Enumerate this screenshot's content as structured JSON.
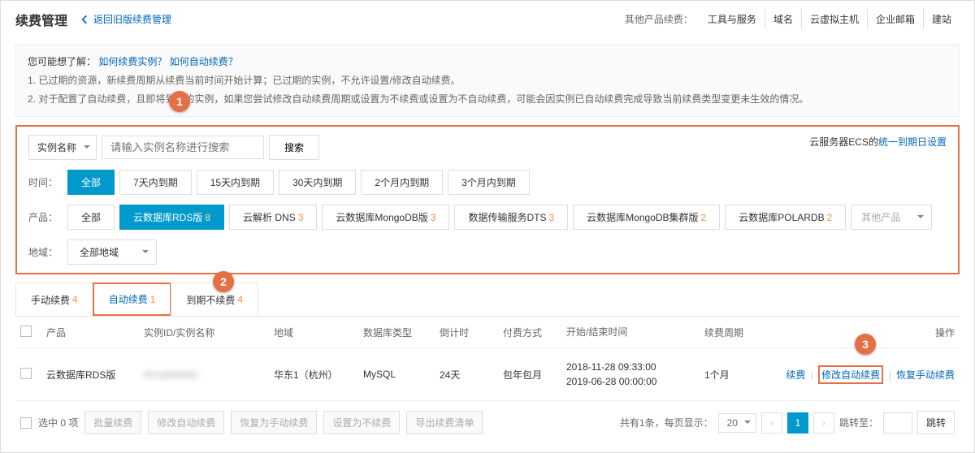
{
  "header": {
    "title": "续费管理",
    "back_link": "返回旧版续费管理",
    "other_label": "其他产品续费：",
    "top_links": [
      "工具与服务",
      "域名",
      "云虚拟主机",
      "企业邮箱",
      "建站"
    ]
  },
  "notice": {
    "you_may": "您可能想了解：",
    "link1": "如何续费实例？",
    "link2": "如何自动续费？",
    "line1": "1. 已过期的资源，新续费周期从续费当前时间开始计算；已过期的实例，不允许设置/修改自动续费。",
    "line2": "2. 对于配置了自动续费，且即将到期的实例，如果您尝试修改自动续费周期或设置为不续费或设置为不自动续费，可能会因实例已自动续费完成导致当前续费类型变更未生效的情况。"
  },
  "filter": {
    "search_type": "实例名称",
    "search_placeholder": "请输入实例名称进行搜索",
    "search_btn": "搜索",
    "ecs_prefix": "云服务器ECS的",
    "ecs_link": "统一到期日设置",
    "time_label": "时间：",
    "time_opts": [
      "全部",
      "7天内到期",
      "15天内到期",
      "30天内到期",
      "2个月内到期",
      "3个月内到期"
    ],
    "prod_label": "产品：",
    "prod_opts": [
      {
        "label": "全部",
        "count": ""
      },
      {
        "label": "云数据库RDS版",
        "count": "8"
      },
      {
        "label": "云解析 DNS",
        "count": "3"
      },
      {
        "label": "云数据库MongoDB版",
        "count": "3"
      },
      {
        "label": "数据传输服务DTS",
        "count": "3"
      },
      {
        "label": "云数据库MongoDB集群版",
        "count": "2"
      },
      {
        "label": "云数据库POLARDB",
        "count": "2"
      }
    ],
    "other_prod": "其他产品",
    "region_label": "地域：",
    "region_value": "全部地域"
  },
  "tabs": [
    {
      "label": "手动续费",
      "count": "4"
    },
    {
      "label": "自动续费",
      "count": "1"
    },
    {
      "label": "到期不续费",
      "count": "4"
    }
  ],
  "table": {
    "headers": {
      "prod": "产品",
      "inst": "实例ID/实例名称",
      "region": "地域",
      "dbtype": "数据库类型",
      "countdown": "倒计时",
      "pay": "付费方式",
      "time": "开始/结束时间",
      "cycle": "续费周期",
      "ops": "操作"
    },
    "row": {
      "prod": "云数据库RDS版",
      "inst": "rm-xxxxxxxx",
      "region": "华东1（杭州）",
      "dbtype": "MySQL",
      "countdown": "24天",
      "pay": "包年包月",
      "start": "2018-11-28 09:33:00",
      "end": "2019-06-28 00:00:00",
      "cycle": "1个月",
      "op_renew": "续费",
      "op_modify": "修改自动续费",
      "op_restore": "恢复手动续费"
    }
  },
  "footer": {
    "selected": "选中 0 项",
    "batch_renew": "批量续费",
    "modify_auto": "修改自动续费",
    "restore_manual": "恢复为手动续费",
    "set_no_renew": "设置为不续费",
    "export": "导出续费清单",
    "total": "共有1条，每页显示：",
    "page_size": "20",
    "page_num": "1",
    "jump_label": "跳转至：",
    "jump_btn": "跳转"
  },
  "steps": {
    "s1": "1",
    "s2": "2",
    "s3": "3"
  }
}
